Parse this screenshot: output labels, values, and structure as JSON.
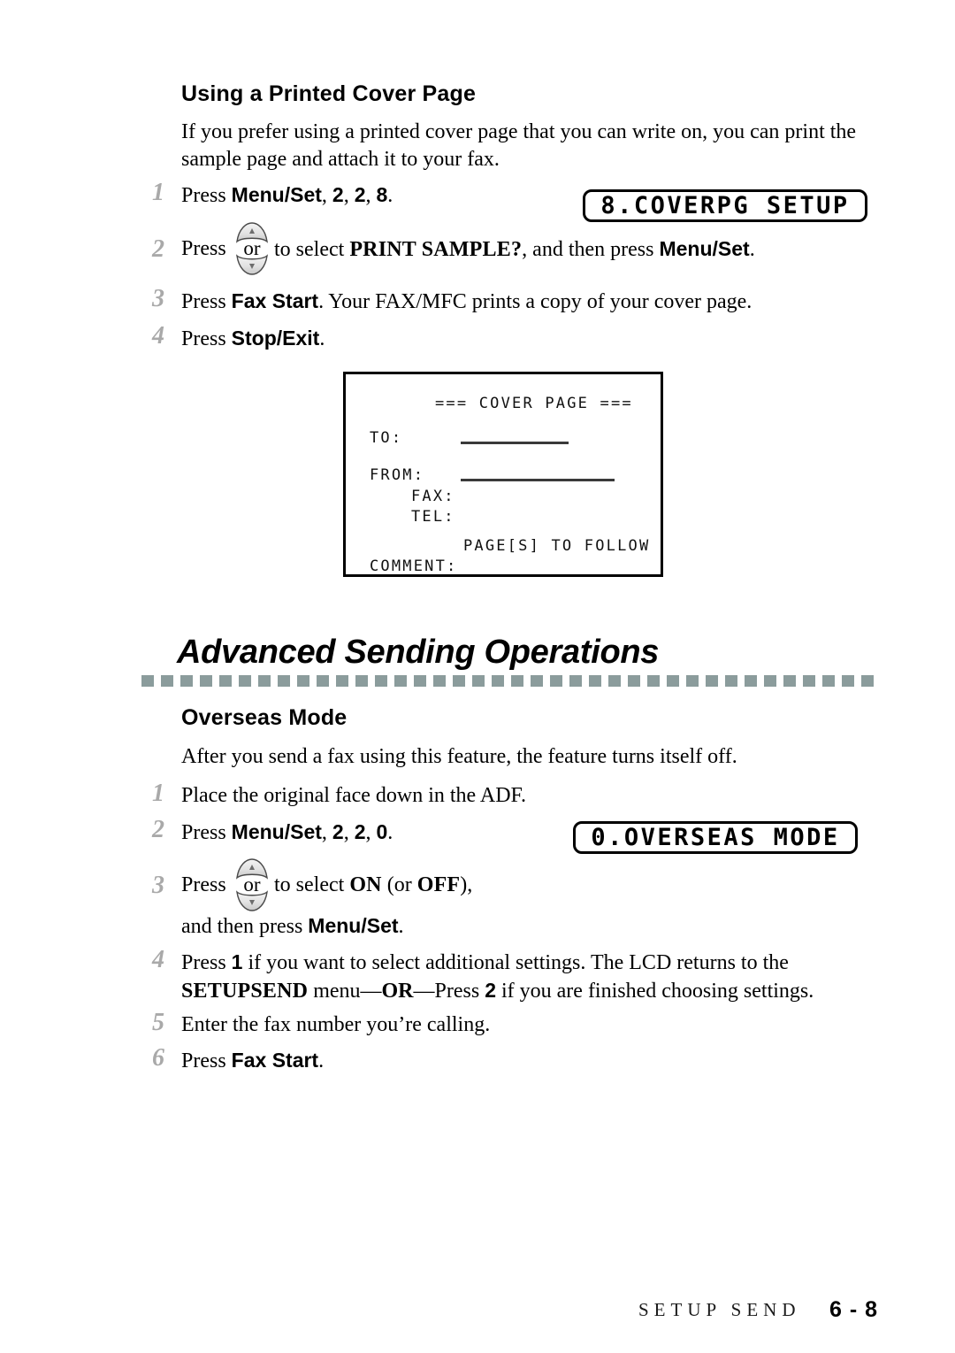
{
  "section_cover": {
    "heading": "Using a Printed Cover Page",
    "intro": "If you prefer using a printed cover page that you can write on, you can print the sample page and attach it to your fax.",
    "steps": [
      {
        "num": "1",
        "pre": "Press ",
        "bold1": "Menu/Set",
        "mid": ", ",
        "bold2": "2",
        "mid2": ", ",
        "bold3": "2",
        "mid3": ", ",
        "bold4": "8",
        "post": "."
      },
      {
        "num": "2",
        "pre": "Press ",
        "mid": " to select ",
        "emph": "PRINT SAMPLE?",
        "mid2": ", and then press ",
        "bold1": "Menu/Set",
        "post": "."
      },
      {
        "num": "3",
        "pre": "Press ",
        "bold1": "Fax Start",
        "post": ". Your FAX/MFC prints a copy of your cover page."
      },
      {
        "num": "4",
        "pre": "Press ",
        "bold1": "Stop/Exit",
        "post": "."
      }
    ],
    "lcd": "8.COVERPG SETUP"
  },
  "cover_sample": {
    "title": "=== COVER PAGE ===",
    "to_label": "TO:",
    "from_label": "FROM:",
    "fax_label": "FAX:",
    "tel_label": "TEL:",
    "pages_label": "PAGE[S] TO FOLLOW",
    "comment_label": "COMMENT:"
  },
  "section_advanced": {
    "title": "Advanced Sending Operations"
  },
  "section_overseas": {
    "heading": "Overseas Mode",
    "intro": "After you send a fax using this feature, the feature turns itself off.",
    "lcd": "0.OVERSEAS MODE",
    "steps": [
      {
        "num": "1",
        "text": "Place the original face down in the ADF."
      },
      {
        "num": "2",
        "pre": "Press ",
        "bold1": "Menu/Set",
        "mid": ", ",
        "bold2": "2",
        "mid2": ", ",
        "bold3": "2",
        "mid3": ", ",
        "bold4": "0",
        "post": "."
      },
      {
        "num": "3",
        "pre": "Press ",
        "mid": " to select ",
        "on": "ON",
        "mid2": " (or ",
        "off": "OFF",
        "post": "),",
        "line2_pre": "and then press ",
        "line2_bold": "Menu/Set",
        "line2_post": "."
      },
      {
        "num": "4",
        "pre": "Press ",
        "bold1": "1",
        "mid": " if you want to select additional settings. The LCD returns to the ",
        "sc1": "SETUP",
        "line2_sc": "SEND",
        "line2_mid": " menu—",
        "line2_bold": "OR",
        "line2_mid2": "—Press ",
        "line2_bold2": "2",
        "line2_post": " if you are finished choosing settings."
      },
      {
        "num": "5",
        "text": "Enter the fax number you’re calling."
      },
      {
        "num": "6",
        "pre": "Press ",
        "bold1": "Fax Start",
        "post": "."
      }
    ]
  },
  "icons": {
    "up_arrow": "▲",
    "down_arrow": "▼",
    "or_label": "or"
  },
  "footer": {
    "label": "SETUP SEND",
    "page": "6 - 8"
  },
  "colors": {
    "rule": "#8b9c9c",
    "step_number": "#a9a9a9"
  }
}
